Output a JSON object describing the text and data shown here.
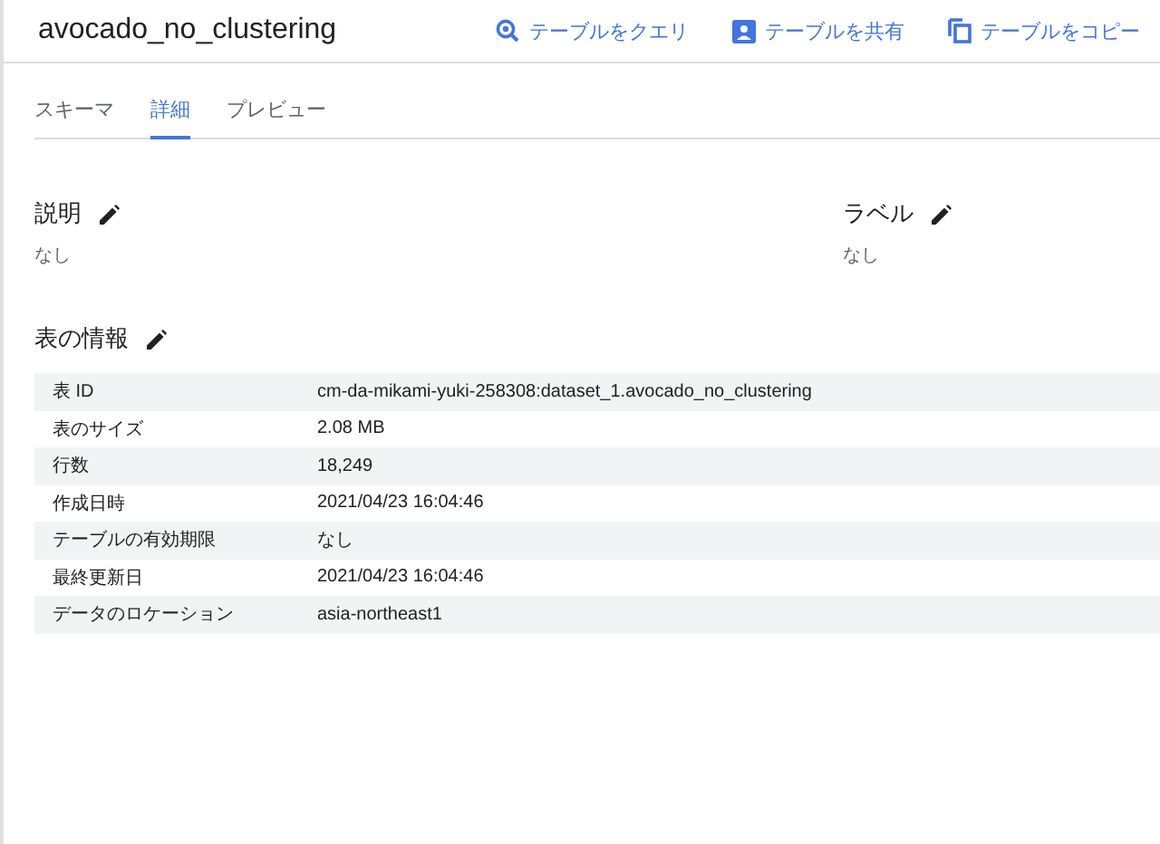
{
  "header": {
    "title": "avocado_no_clustering",
    "actions": [
      {
        "kind": "query",
        "label": "テーブルをクエリ"
      },
      {
        "kind": "share",
        "label": "テーブルを共有"
      },
      {
        "kind": "copy",
        "label": "テーブルをコピー"
      }
    ]
  },
  "tabs": [
    {
      "label": "スキーマ",
      "selected": false
    },
    {
      "label": "詳細",
      "selected": true
    },
    {
      "label": "プレビュー",
      "selected": false
    }
  ],
  "sections": [
    {
      "title": "説明",
      "value": "なし"
    },
    {
      "title": "ラベル",
      "value": "なし"
    }
  ],
  "table_info": {
    "title": "表の情報",
    "rows": [
      {
        "label": "表 ID",
        "value": "cm-da-mikami-yuki-258308:dataset_1.avocado_no_clustering"
      },
      {
        "label": "表のサイズ",
        "value": "2.08 MB"
      },
      {
        "label": "行数",
        "value": "18,249"
      },
      {
        "label": "作成日時",
        "value": "2021/04/23 16:04:46"
      },
      {
        "label": "テーブルの有効期限",
        "value": "なし"
      },
      {
        "label": "最終更新日",
        "value": "2021/04/23 16:04:46"
      },
      {
        "label": "データのロケーション",
        "value": "asia-northeast1"
      }
    ]
  }
}
